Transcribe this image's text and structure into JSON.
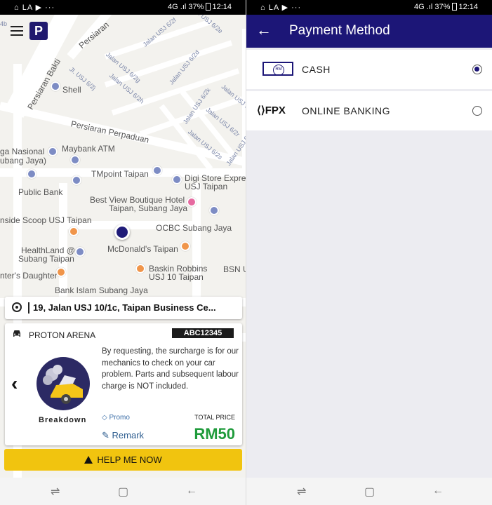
{
  "status_bar": {
    "left_icons": "⌂ LA ▶ ···",
    "right_text": "4G .ıl 37%",
    "time": "12:14"
  },
  "left": {
    "map": {
      "partial_top_label": "4b",
      "labels": [
        "Persiaran",
        "Persiaran Bakti",
        "Shell",
        "Persiaran Perpaduan",
        "Maybank ATM",
        "ga Nasional",
        "ubang Jaya)",
        "TMpoint Taipan",
        "Digi Store Expres",
        "USJ Taipan",
        "Public Bank",
        "Best View Boutique Hotel",
        "Taipan, Subang Jaya",
        "nside Scoop USJ Taipan",
        "OCBC Subang Jaya",
        "HealthLand @",
        "Subang Taipan",
        "McDonald's Taipan",
        "Baskin Robbins",
        "USJ 10 Taipan",
        "BSN U",
        "nter's Daughter",
        "Bank Islam Subang Jaya"
      ],
      "streets": [
        "Jalan USJ 6/2f",
        "Jalan USJ 6/2g",
        "Jalan USJ 6/2d",
        "Jl. USJ 6/2j",
        "Jalan USJ 6/2h",
        "Jalan USJ 6/2k",
        "Jalan USJ 6/2l",
        "Jalan USJ 6/2r",
        "Jalan USJ 6/2s",
        "Jalan USJ 6/2t",
        "Jalan USJ 6/2e"
      ]
    },
    "address": "19, Jalan USJ 10/1c, Taipan Business Ce...",
    "vehicle": {
      "name": "PROTON ARENA",
      "plate": "ABC12345"
    },
    "service": {
      "name": "Breakdown",
      "description": "By requesting, the surcharge is for our mechanics to check on your car problem. Parts and subsequent labour charge is NOT included.",
      "promo_label": "Promo",
      "remark_label": "Remark",
      "total_price_label": "TOTAL PRICE",
      "price": "RM50"
    },
    "help_button": "HELP ME NOW"
  },
  "right": {
    "title": "Payment Method",
    "options": [
      {
        "label": "CASH",
        "icon": "cash-icon",
        "selected": true
      },
      {
        "label": "ONLINE BANKING",
        "icon": "fpx-icon",
        "icon_text": "FPX",
        "selected": false
      }
    ]
  },
  "nav_icons": [
    "recent-apps-icon",
    "home-icon",
    "back-icon"
  ],
  "colors": {
    "primary": "#1c1677",
    "accent": "#f1c40f",
    "price": "#1f9b3b"
  }
}
